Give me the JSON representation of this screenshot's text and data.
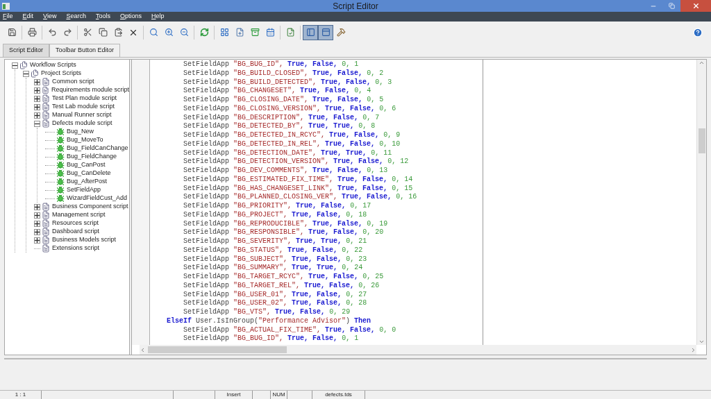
{
  "window": {
    "title": "Script Editor"
  },
  "menu": [
    "File",
    "Edit",
    "View",
    "Search",
    "Tools",
    "Options",
    "Help"
  ],
  "view_toggles": [
    {
      "selected": true
    },
    {
      "selected": true
    }
  ],
  "tabs": [
    {
      "label": "Script Editor",
      "selected": true
    },
    {
      "label": "Toolbar Button Editor",
      "selected": false
    }
  ],
  "tree": [
    {
      "label": "Workflow Scripts",
      "kind": "root",
      "expanded": true,
      "children": [
        {
          "label": "Project Scripts",
          "kind": "root",
          "expanded": true,
          "children": [
            {
              "label": "Common script",
              "kind": "script",
              "expanded": false
            },
            {
              "label": "Requirements module script",
              "kind": "script",
              "expanded": false
            },
            {
              "label": "Test Plan module script",
              "kind": "script",
              "expanded": false
            },
            {
              "label": "Test Lab module script",
              "kind": "script",
              "expanded": false
            },
            {
              "label": "Manual Runner script",
              "kind": "script",
              "expanded": false
            },
            {
              "label": "Defects module script",
              "kind": "script",
              "expanded": true,
              "children": [
                {
                  "label": "Bug_New",
                  "kind": "function"
                },
                {
                  "label": "Bug_MoveTo",
                  "kind": "function"
                },
                {
                  "label": "Bug_FieldCanChange",
                  "kind": "function"
                },
                {
                  "label": "Bug_FieldChange",
                  "kind": "function"
                },
                {
                  "label": "Bug_CanPost",
                  "kind": "function"
                },
                {
                  "label": "Bug_CanDelete",
                  "kind": "function"
                },
                {
                  "label": "Bug_AfterPost",
                  "kind": "function"
                },
                {
                  "label": "SetFieldApp",
                  "kind": "function"
                },
                {
                  "label": "WizardFieldCust_Add",
                  "kind": "function"
                }
              ]
            },
            {
              "label": "Business Component script",
              "kind": "script",
              "expanded": false
            },
            {
              "label": "Management script",
              "kind": "script",
              "expanded": false
            },
            {
              "label": "Resources script",
              "kind": "script",
              "expanded": false
            },
            {
              "label": "Dashboard script",
              "kind": "script",
              "expanded": false
            },
            {
              "label": "Business Models script",
              "kind": "script",
              "expanded": false
            },
            {
              "label": "Extensions script",
              "kind": "script"
            }
          ]
        }
      ]
    }
  ],
  "code": [
    {
      "kind": "call",
      "func": "SetFieldApp",
      "field": "\"BG_BUG_ID\",",
      "flags": [
        "True,",
        "False,"
      ],
      "nums": [
        "0,",
        "1"
      ]
    },
    {
      "kind": "call",
      "func": "SetFieldApp",
      "field": "\"BG_BUILD_CLOSED\",",
      "flags": [
        "True,",
        "False,"
      ],
      "nums": [
        "0,",
        "2"
      ]
    },
    {
      "kind": "call",
      "func": "SetFieldApp",
      "field": "\"BG_BUILD_DETECTED\",",
      "flags": [
        "True,",
        "False,"
      ],
      "nums": [
        "0,",
        "3"
      ]
    },
    {
      "kind": "call",
      "func": "SetFieldApp",
      "field": "\"BG_CHANGESET\",",
      "flags": [
        "True,",
        "False,"
      ],
      "nums": [
        "0,",
        "4"
      ]
    },
    {
      "kind": "call",
      "func": "SetFieldApp",
      "field": "\"BG_CLOSING_DATE\",",
      "flags": [
        "True,",
        "False,"
      ],
      "nums": [
        "0,",
        "5"
      ]
    },
    {
      "kind": "call",
      "func": "SetFieldApp",
      "field": "\"BG_CLOSING_VERSION\",",
      "flags": [
        "True,",
        "False,"
      ],
      "nums": [
        "0,",
        "6"
      ]
    },
    {
      "kind": "call",
      "func": "SetFieldApp",
      "field": "\"BG_DESCRIPTION\",",
      "flags": [
        "True,",
        "False,"
      ],
      "nums": [
        "0,",
        "7"
      ]
    },
    {
      "kind": "call",
      "func": "SetFieldApp",
      "field": "\"BG_DETECTED_BY\",",
      "flags": [
        "True,",
        "True,"
      ],
      "nums": [
        "0,",
        "8"
      ]
    },
    {
      "kind": "call",
      "func": "SetFieldApp",
      "field": "\"BG_DETECTED_IN_RCYC\",",
      "flags": [
        "True,",
        "False,"
      ],
      "nums": [
        "0,",
        "9"
      ]
    },
    {
      "kind": "call",
      "func": "SetFieldApp",
      "field": "\"BG_DETECTED_IN_REL\",",
      "flags": [
        "True,",
        "False,"
      ],
      "nums": [
        "0,",
        "10"
      ]
    },
    {
      "kind": "call",
      "func": "SetFieldApp",
      "field": "\"BG_DETECTION_DATE\",",
      "flags": [
        "True,",
        "True,"
      ],
      "nums": [
        "0,",
        "11"
      ]
    },
    {
      "kind": "call",
      "func": "SetFieldApp",
      "field": "\"BG_DETECTION_VERSION\",",
      "flags": [
        "True,",
        "False,"
      ],
      "nums": [
        "0,",
        "12"
      ]
    },
    {
      "kind": "call",
      "func": "SetFieldApp",
      "field": "\"BG_DEV_COMMENTS\",",
      "flags": [
        "True,",
        "False,"
      ],
      "nums": [
        "0,",
        "13"
      ]
    },
    {
      "kind": "call",
      "func": "SetFieldApp",
      "field": "\"BG_ESTIMATED_FIX_TIME\",",
      "flags": [
        "True,",
        "False,"
      ],
      "nums": [
        "0,",
        "14"
      ]
    },
    {
      "kind": "call",
      "func": "SetFieldApp",
      "field": "\"BG_HAS_CHANGESET_LINK\",",
      "flags": [
        "True,",
        "False,"
      ],
      "nums": [
        "0,",
        "15"
      ]
    },
    {
      "kind": "call",
      "func": "SetFieldApp",
      "field": "\"BG_PLANNED_CLOSING_VER\",",
      "flags": [
        "True,",
        "False,"
      ],
      "nums": [
        "0,",
        "16"
      ]
    },
    {
      "kind": "call",
      "func": "SetFieldApp",
      "field": "\"BG_PRIORITY\",",
      "flags": [
        "True,",
        "False,"
      ],
      "nums": [
        "0,",
        "17"
      ]
    },
    {
      "kind": "call",
      "func": "SetFieldApp",
      "field": "\"BG_PROJECT\",",
      "flags": [
        "True,",
        "False,"
      ],
      "nums": [
        "0,",
        "18"
      ]
    },
    {
      "kind": "call",
      "func": "SetFieldApp",
      "field": "\"BG_REPRODUCIBLE\",",
      "flags": [
        "True,",
        "False,"
      ],
      "nums": [
        "0,",
        "19"
      ]
    },
    {
      "kind": "call",
      "func": "SetFieldApp",
      "field": "\"BG_RESPONSIBLE\",",
      "flags": [
        "True,",
        "False,"
      ],
      "nums": [
        "0,",
        "20"
      ]
    },
    {
      "kind": "call",
      "func": "SetFieldApp",
      "field": "\"BG_SEVERITY\",",
      "flags": [
        "True,",
        "True,"
      ],
      "nums": [
        "0,",
        "21"
      ]
    },
    {
      "kind": "call",
      "func": "SetFieldApp",
      "field": "\"BG_STATUS\",",
      "flags": [
        "True,",
        "False,"
      ],
      "nums": [
        "0,",
        "22"
      ]
    },
    {
      "kind": "call",
      "func": "SetFieldApp",
      "field": "\"BG_SUBJECT\",",
      "flags": [
        "True,",
        "False,"
      ],
      "nums": [
        "0,",
        "23"
      ]
    },
    {
      "kind": "call",
      "func": "SetFieldApp",
      "field": "\"BG_SUMMARY\",",
      "flags": [
        "True,",
        "True,"
      ],
      "nums": [
        "0,",
        "24"
      ]
    },
    {
      "kind": "call",
      "func": "SetFieldApp",
      "field": "\"BG_TARGET_RCYC\",",
      "flags": [
        "True,",
        "False,"
      ],
      "nums": [
        "0,",
        "25"
      ]
    },
    {
      "kind": "call",
      "func": "SetFieldApp",
      "field": "\"BG_TARGET_REL\",",
      "flags": [
        "True,",
        "False,"
      ],
      "nums": [
        "0,",
        "26"
      ]
    },
    {
      "kind": "call",
      "func": "SetFieldApp",
      "field": "\"BG_USER_01\",",
      "flags": [
        "True,",
        "False,"
      ],
      "nums": [
        "0,",
        "27"
      ]
    },
    {
      "kind": "call",
      "func": "SetFieldApp",
      "field": "\"BG_USER_02\",",
      "flags": [
        "True,",
        "False,"
      ],
      "nums": [
        "0,",
        "28"
      ]
    },
    {
      "kind": "call",
      "func": "SetFieldApp",
      "field": "\"BG_VTS\",",
      "flags": [
        "True,",
        "False,"
      ],
      "nums": [
        "0,",
        "29"
      ]
    },
    {
      "kind": "branch",
      "keyword": "ElseIf",
      "expr": "User.IsInGroup(",
      "arg": "\"Performance Advisor\"",
      "close": ")",
      "then": "Then"
    },
    {
      "kind": "call",
      "func": "SetFieldApp",
      "field": "\"BG_ACTUAL_FIX_TIME\",",
      "flags": [
        "True,",
        "False,"
      ],
      "nums": [
        "0,",
        "0"
      ]
    },
    {
      "kind": "call",
      "func": "SetFieldApp",
      "field": "\"BG_BUG_ID\",",
      "flags": [
        "True,",
        "False,"
      ],
      "nums": [
        "0,",
        "1"
      ]
    }
  ],
  "status_bar": {
    "position": "1 : 1",
    "mode": "Insert",
    "num": "NUM",
    "file": "defects.tds"
  }
}
